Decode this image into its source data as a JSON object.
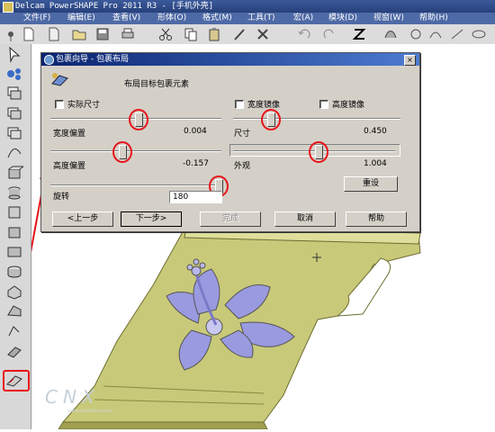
{
  "app": {
    "title": "Delcam PowerSHAPE Pro 2011 R3 - [手机外壳]"
  },
  "menu": [
    "文件(F)",
    "编辑(E)",
    "查看(V)",
    "形体(O)",
    "格式(M)",
    "工具(T)",
    "宏(A)",
    "模块(D)",
    "视窗(W)",
    "帮助(H)"
  ],
  "dialog": {
    "title": "包裹向导 - 包裹布局",
    "heading": "布局目标包裹元素",
    "close_label": "×",
    "left": {
      "actual_size_label": "实际尺寸",
      "actual_size_checked": false,
      "width_offset_label": "宽度偏置",
      "width_offset_value": "0.004",
      "height_offset_label": "高度偏置",
      "height_offset_value": "-0.157",
      "rotate_label": "旋转",
      "rotate_value": "180"
    },
    "right": {
      "width_mirror_label": "宽度镜像",
      "width_mirror_checked": false,
      "height_mirror_label": "高度镜像",
      "height_mirror_checked": false,
      "size_label": "尺寸",
      "size_value": "0.450",
      "appearance_label": "外观",
      "appearance_value": "1.004",
      "reset_label": "重设"
    },
    "buttons": {
      "back": "<上一步",
      "next": "下一步>",
      "finish": "完成",
      "cancel": "取消",
      "help": "帮助"
    },
    "sliders": {
      "width_offset_level": 0.7,
      "height_offset_level": 0.4,
      "rotate_level": 1.0,
      "size_level": 0.23,
      "appearance_level": 0.51
    }
  },
  "watermark": {
    "text": "CNX",
    "sub": "www.cnxitzone.com"
  },
  "colors": {
    "accent_red": "#e8131a",
    "title_blue": "#0a2470",
    "model_yellow": "#c8c87a",
    "flower_purple": "#9a9ae0"
  }
}
